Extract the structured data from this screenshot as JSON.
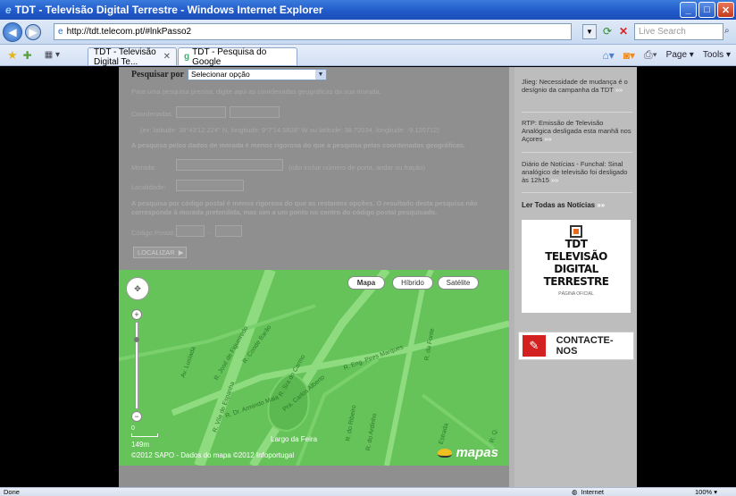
{
  "window": {
    "title": "TDT - Televisão Digital Terrestre - Windows Internet Explorer",
    "icon": "ie-icon"
  },
  "browser": {
    "url": "http://tdt.telecom.pt/#lnkPasso2",
    "search_placeholder": "Live Search",
    "tabs": [
      {
        "label": "TDT - Televisão Digital Te...",
        "active": true
      },
      {
        "label": "TDT - Pesquisa do Google",
        "active": false
      }
    ],
    "tools": {
      "page": "Page",
      "tools": "Tools"
    },
    "status": "Done",
    "zone": "Internet",
    "zoom": "100%"
  },
  "form": {
    "search_label": "Pesquisar por",
    "select_value": "Selecionar opção",
    "coords_intro": "Para uma pesquisa precisa, digite aqui as coordenadas geográficas da sua morada.",
    "coords_label": "Coordenadas:",
    "coords_example": "(ex: latitude: 38°43'12.224\" N, longitude: 9°7'14.5828\" W ou latitude: 38.72034, longitude: -9.120712)",
    "address_intro": "A pesquisa pelos dados de morada é menos rigorosa do que a pesquisa pelas coordenadas geográficas.",
    "address_label": "Morada:",
    "address_hint": "(não incluir número de porta, andar ou fração)",
    "locality_label": "Localidade:",
    "postal_intro": "A pesquisa por código postal é menos rigorosa do que as restantes opções. O resultado desta pesquisa não corresponde à morada pretendida, mas sim a um ponto no centro do código postal pesquisado.",
    "postal_label": "Código Postal:",
    "postal_sep": "-",
    "locate_button": "LOCALIZAR"
  },
  "map": {
    "types": [
      "Mapa",
      "Híbrido",
      "Satélite"
    ],
    "active_type": "Mapa",
    "scale_top": "0",
    "scale_label": "149m",
    "copyright": "©2012 SAPO - Dados do mapa ©2012 Infoportugal",
    "logo": "mapas",
    "streets": [
      "R. Vila de Espanha",
      "R. José de Figueiredo",
      "R. Conde Barão",
      "Av. Lusíada",
      "R. Sra do Carmo",
      "Pra. Carlos Alberto",
      "R. Eng. Pires Marques",
      "R. Dr. Armindo Maia",
      "R. da Fonte",
      "R. do Ribeiro",
      "Largo da Feira",
      "R. do Ardinho",
      "Estrada",
      "R. Q."
    ]
  },
  "sidebar": {
    "news": [
      {
        "text": "Jlieg: Necessidade de mudança é o desígnio da campanha da TDT",
        "more": "»»"
      },
      {
        "text": "RTP: Emissão de Televisão Analógica desligada esta manhã nos Açores",
        "more": "»»"
      },
      {
        "text": "Diário de Notícias - Funchal: Sinal analógico de televisão foi desligado às 12h15",
        "more": "»»"
      }
    ],
    "read_all": "Ler Todas as Notícias",
    "read_all_more": "»»",
    "logo_lines": [
      "TDT",
      "TELEVISÃO",
      "DIGITAL",
      "TERRESTRE"
    ],
    "logo_sub": "PÁGINA OFICIAL",
    "contact": "CONTACTE-NOS"
  }
}
